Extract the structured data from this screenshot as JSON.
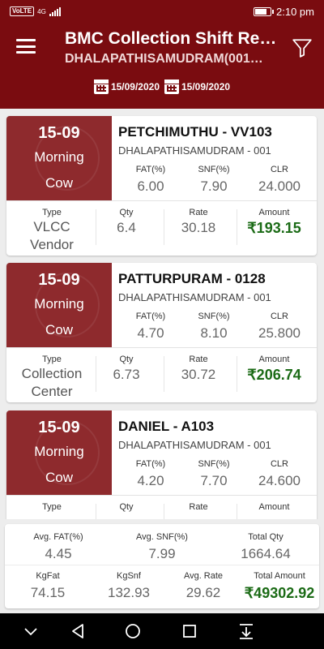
{
  "status_bar": {
    "carrier_badge": "VoLTE",
    "network": "4G",
    "time": "2:10 pm",
    "battery_level": 0.85
  },
  "app_bar": {
    "title": "BMC Collection Shift Re…",
    "subtitle": "DHALAPATHISAMUDRAM(001…",
    "from_date": "15/09/2020",
    "to_date": "15/09/2020"
  },
  "labels": {
    "fat": "FAT(%)",
    "snf": "SNF(%)",
    "clr": "CLR",
    "type": "Type",
    "qty": "Qty",
    "rate": "Rate",
    "amount": "Amount"
  },
  "records": [
    {
      "date": "15-09",
      "shift": "Morning",
      "animal": "Cow",
      "name": "PETCHIMUTHU - VV103",
      "center": "DHALAPATHISAMUDRAM - 001",
      "fat": "6.00",
      "snf": "7.90",
      "clr": "24.000",
      "type_line1": "VLCC",
      "type_line2": "Vendor",
      "qty": "6.4",
      "rate": "30.18",
      "amount": "₹193.15"
    },
    {
      "date": "15-09",
      "shift": "Morning",
      "animal": "Cow",
      "name": "PATTURPURAM - 0128",
      "center": "DHALAPATHISAMUDRAM - 001",
      "fat": "4.70",
      "snf": "8.10",
      "clr": "25.800",
      "type_line1": "Collection",
      "type_line2": "Center",
      "qty": "6.73",
      "rate": "30.72",
      "amount": "₹206.74"
    },
    {
      "date": "15-09",
      "shift": "Morning",
      "animal": "Cow",
      "name": "DANIEL - A103",
      "center": "DHALAPATHISAMUDRAM - 001",
      "fat": "4.20",
      "snf": "7.70",
      "clr": "24.600",
      "type_line1": "",
      "type_line2": "",
      "qty": "",
      "rate": "",
      "amount": ""
    }
  ],
  "summary": {
    "avg_fat_label": "Avg. FAT(%)",
    "avg_fat": "4.45",
    "avg_snf_label": "Avg. SNF(%)",
    "avg_snf": "7.99",
    "total_qty_label": "Total Qty",
    "total_qty": "1664.64",
    "kgfat_label": "KgFat",
    "kgfat": "74.15",
    "kgsnf_label": "KgSnf",
    "kgsnf": "132.93",
    "avg_rate_label": "Avg. Rate",
    "avg_rate": "29.62",
    "total_amount_label": "Total Amount",
    "total_amount": "₹49302.92"
  },
  "colors": {
    "primary": "#7a0c10",
    "card_date_bg": "#8e2a2d",
    "amount": "#1b6b16"
  },
  "icons": [
    "menu-icon",
    "filter-icon",
    "calendar-icon",
    "chevron-down-icon",
    "back-icon",
    "home-icon",
    "recents-icon",
    "notification-pull-icon"
  ]
}
